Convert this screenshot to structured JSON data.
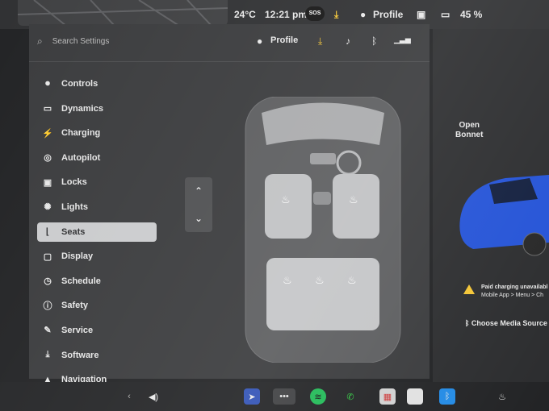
{
  "status_bar": {
    "temperature": "24°C",
    "time": "12:21 pm",
    "sos": "SOS",
    "profile": "Profile",
    "battery": "45 %"
  },
  "search": {
    "placeholder": "Search Settings",
    "icon": "search-icon"
  },
  "top_bar": {
    "profile": "Profile",
    "icons": [
      "download-icon",
      "bell-icon",
      "bluetooth-icon",
      "lte-signal-icon"
    ]
  },
  "nav": {
    "items": [
      {
        "label": "Controls",
        "icon": "toggle-icon",
        "glyph": "⏺"
      },
      {
        "label": "Dynamics",
        "icon": "car-icon",
        "glyph": "▭"
      },
      {
        "label": "Charging",
        "icon": "lightning-icon",
        "glyph": "⚡"
      },
      {
        "label": "Autopilot",
        "icon": "steering-wheel-icon",
        "glyph": "◎"
      },
      {
        "label": "Locks",
        "icon": "lock-icon",
        "glyph": "▣"
      },
      {
        "label": "Lights",
        "icon": "sun-icon",
        "glyph": "✺"
      },
      {
        "label": "Seats",
        "icon": "seat-icon",
        "glyph": "⌊"
      },
      {
        "label": "Display",
        "icon": "display-icon",
        "glyph": "▢"
      },
      {
        "label": "Schedule",
        "icon": "clock-icon",
        "glyph": "◷"
      },
      {
        "label": "Safety",
        "icon": "info-icon",
        "glyph": "ⓘ"
      },
      {
        "label": "Service",
        "icon": "wrench-icon",
        "glyph": "✎"
      },
      {
        "label": "Software",
        "icon": "download-icon",
        "glyph": "⤓"
      },
      {
        "label": "Navigation",
        "icon": "navigation-icon",
        "glyph": "▲"
      }
    ],
    "active": "Seats"
  },
  "seat_stepper": {
    "up_icon": "chevron-up-icon",
    "down_icon": "chevron-down-icon"
  },
  "right_panel": {
    "open_bonnet": [
      "Open",
      "Bonnet"
    ],
    "alert_title": "Paid charging unavailabl",
    "alert_body": "Mobile App > Menu > Ch",
    "media_source": "Choose Media Source"
  },
  "dock": {
    "items": [
      "navigation-icon",
      "volume-icon",
      "more-icon",
      "spotify-icon",
      "phone-icon",
      "calendar-icon",
      "toybox-icon",
      "bluetooth-icon",
      "seat-heater-icon"
    ]
  },
  "colors": {
    "accent_yellow": "#f4c430",
    "spotify": "#1db954",
    "phone": "#2ecc40",
    "bluetooth": "#1e88e5",
    "car_blue": "#1f4fd6"
  }
}
